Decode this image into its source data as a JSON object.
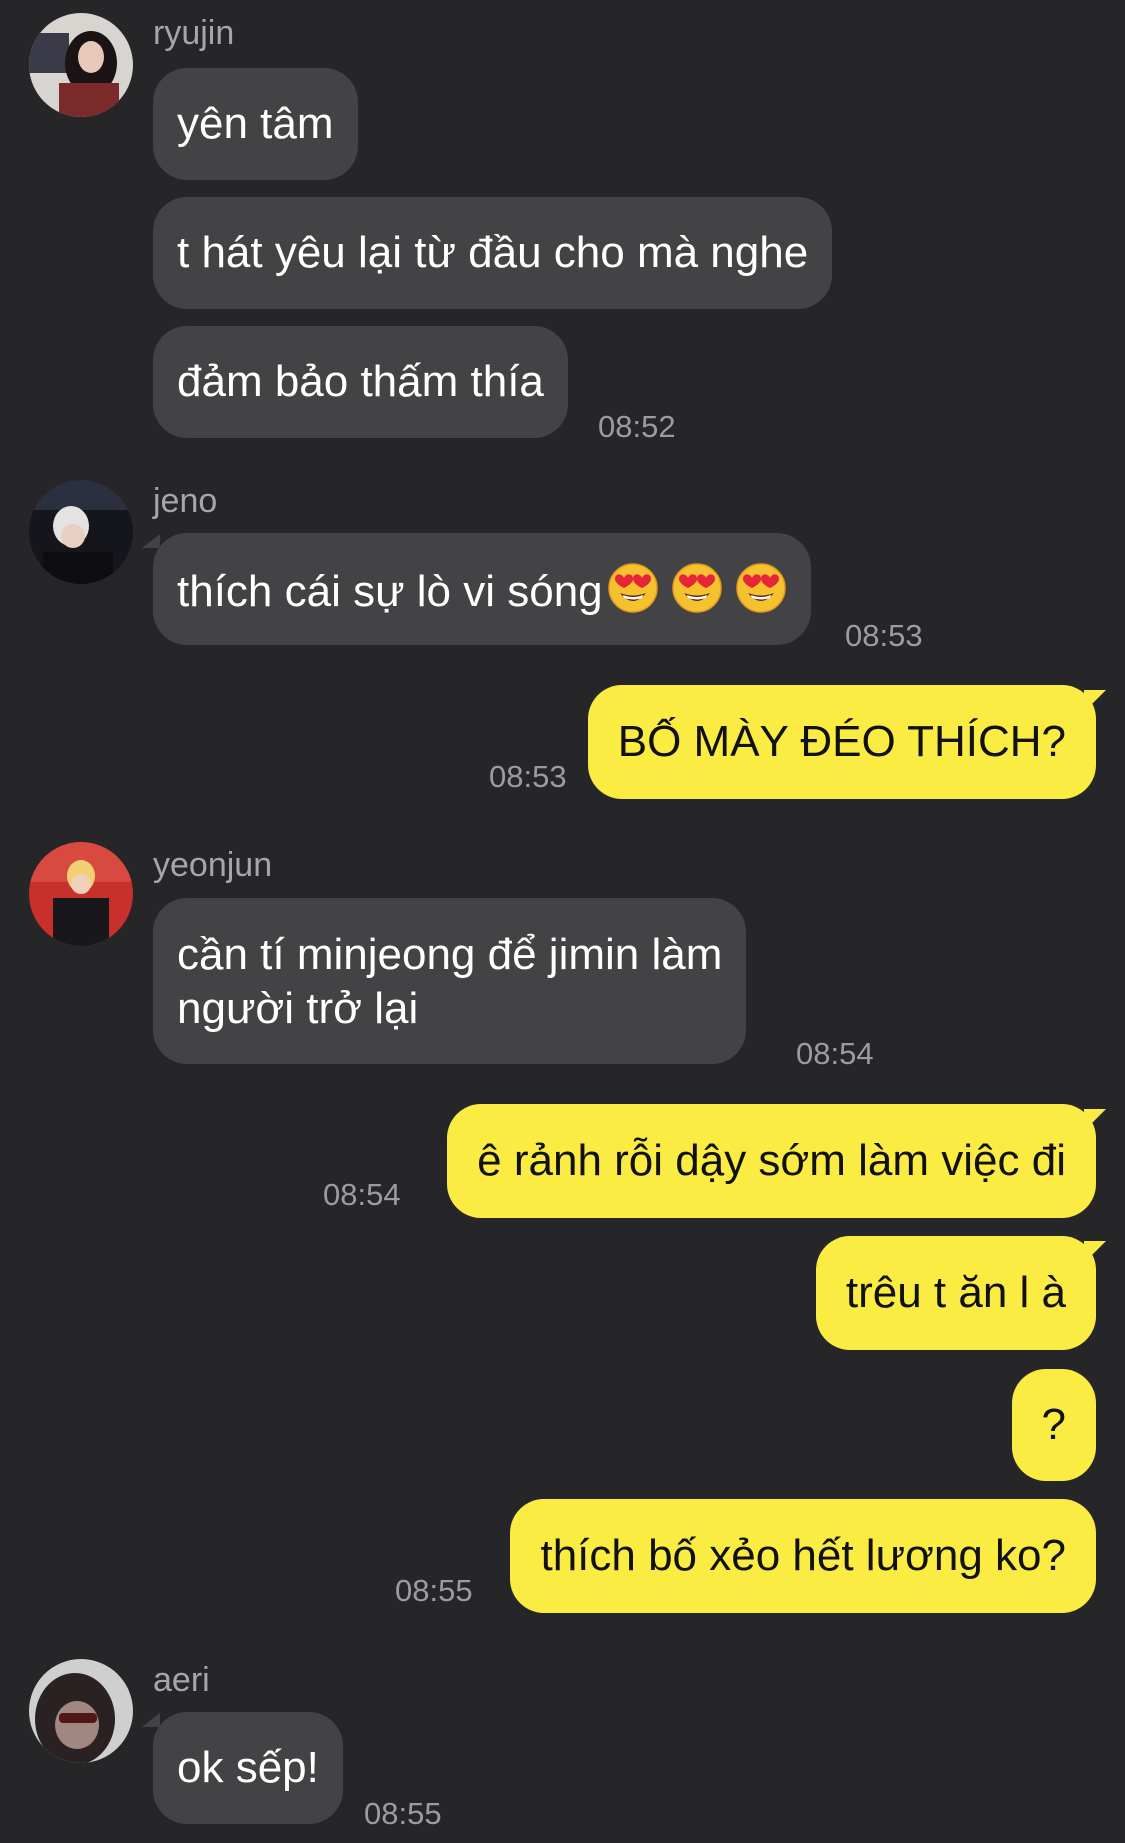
{
  "messages": [
    {
      "sender": "ryujin",
      "texts": [
        "yên tâm",
        "t hát yêu lại từ đầu cho mà nghe",
        "đảm bảo thấm thía"
      ],
      "time": "08:52"
    },
    {
      "sender": "jeno",
      "text": "thích cái sự lò vi sóng",
      "emojis": [
        "heart-eyes",
        "heart-eyes",
        "heart-eyes"
      ],
      "time": "08:53"
    },
    {
      "from_me": true,
      "text": "BỐ MÀY ĐÉO THÍCH?",
      "time": "08:53"
    },
    {
      "sender": "yeonjun",
      "lines": [
        "cần tí minjeong để jimin làm",
        "người trở lại"
      ],
      "time": "08:54"
    },
    {
      "from_me": true,
      "texts": [
        "ê rảnh rỗi dậy sớm làm việc đi",
        "trêu t ăn l à",
        "?",
        "thích bố xẻo hết lương ko?"
      ],
      "times": [
        "08:54",
        "08:55"
      ]
    },
    {
      "sender": "aeri",
      "text": "ok sếp!",
      "time": "08:55"
    }
  ],
  "colors": {
    "background": "#262628",
    "incoming_bubble": "#434346",
    "outgoing_bubble": "#fbec44",
    "name_text": "#a5a5aa",
    "time_text": "#9b9ba0"
  }
}
